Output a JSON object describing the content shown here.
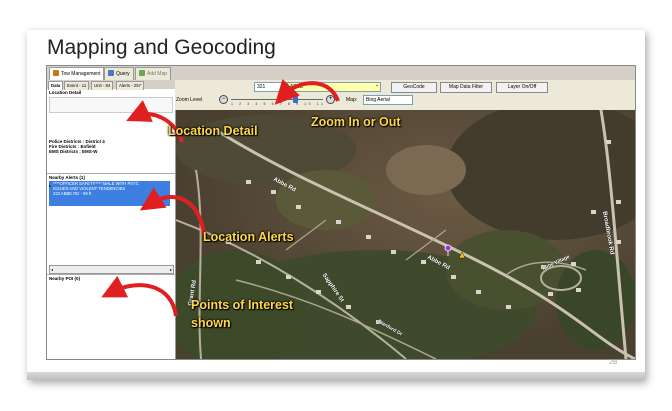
{
  "slide": {
    "title": "Mapping and Geocoding",
    "page_number": "28"
  },
  "app": {
    "tabs": [
      {
        "label": "Tow Management",
        "icon": "tow-truck-icon"
      },
      {
        "label": "Query",
        "icon": "query-icon"
      },
      {
        "label": "Add Map",
        "icon": "map-icon"
      }
    ],
    "toolbar": {
      "address_number": "321",
      "address_street": "ABBE",
      "geocode_button": "GeoCode",
      "map_data_filter_button": "Map Data Filter",
      "layer_onoff_button": "Layer On/Off",
      "zoom_label": "Zoom Level",
      "zoom_ticks": "1 2 3 4 5 6 7 8 9 10 11",
      "zoom_level": 8,
      "zoom_max": 11,
      "map_type_label": "Map:",
      "map_type_value": "Bing Aerial"
    },
    "left_panel": {
      "tabs": [
        "Data",
        "Event - 11",
        "Unit - 84",
        "Alerts - 257"
      ],
      "location_detail_header": "Location Detail",
      "districts": [
        "Police Districts : District 4",
        "Fire Districts : Enfield",
        "EMS Districts : EMS-W"
      ],
      "nearby_alerts_header": "Nearby Alerts (1)",
      "alert_lines": [
        "****OFFICER SAFETY**** MALE WITH PSYC",
        "ISSUES AND VIOLENT TENDENCIES",
        "323 ABBE RD - 99 ft"
      ],
      "nearby_poi_header": "Nearby POI (0)"
    },
    "map": {
      "road_labels": {
        "abbe_rd_upper": "Abbe Rd",
        "abbe_rd_lower": "Abbe Rd",
        "broadbrook_rd": "Broadbrook Rd",
        "sapphire_st": "Sapphire St",
        "grant_rd": "Grant Rd",
        "village": "Abbe Village",
        "stanford": "Stanford Dr"
      }
    }
  },
  "annotations": {
    "location_detail": "Location Detail",
    "zoom": "Zoom In or Out",
    "location_alerts": "Location Alerts",
    "poi_line1": "Points of Interest",
    "poi_line2": "shown",
    "color": "#ffd84a",
    "arrow_color": "#e02020"
  }
}
